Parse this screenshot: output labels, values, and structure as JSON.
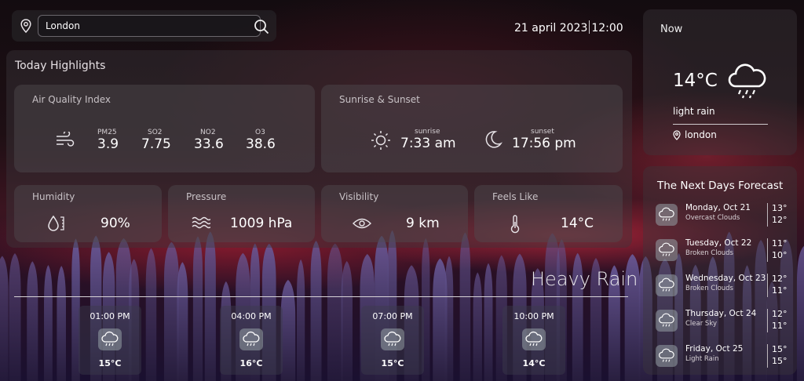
{
  "search": {
    "value": "London"
  },
  "header": {
    "date": "21 april 2023",
    "time": "12:00"
  },
  "highlights": {
    "title": "Today Highlights",
    "air_quality": {
      "label": "Air Quality Index",
      "items": [
        {
          "name": "PM25",
          "value": "3.9"
        },
        {
          "name": "SO2",
          "value": "7.75"
        },
        {
          "name": "NO2",
          "value": "33.6"
        },
        {
          "name": "O3",
          "value": "38.6"
        }
      ]
    },
    "sun": {
      "label": "Sunrise & Sunset",
      "sunrise_label": "sunrise",
      "sunrise": "7:33 am",
      "sunset_label": "sunset",
      "sunset": "17:56 pm"
    },
    "humidity": {
      "label": "Humidity",
      "value": "90%"
    },
    "pressure": {
      "label": "Pressure",
      "value": "1009 hPa"
    },
    "visibility": {
      "label": "Visibility",
      "value": "9 km"
    },
    "feels_like": {
      "label": "Feels Like",
      "value": "14°C"
    }
  },
  "condition": "Heavy Rain",
  "hourly": [
    {
      "time": "01:00 PM",
      "temp": "15°C",
      "icon": "cloud-rain-icon"
    },
    {
      "time": "04:00 PM",
      "temp": "16°C",
      "icon": "cloud-rain-icon"
    },
    {
      "time": "07:00 PM",
      "temp": "15°C",
      "icon": "cloud-rain-icon"
    },
    {
      "time": "10:00 PM",
      "temp": "14°C",
      "icon": "cloud-rain-icon"
    }
  ],
  "now": {
    "label": "Now",
    "temp": "14°C",
    "description": "light rain",
    "location": "london"
  },
  "forecast": {
    "title": "The Next Days Forecast",
    "days": [
      {
        "day": "Monday, Oct 21",
        "desc": "Overcast Clouds",
        "high": "13°",
        "low": "12°"
      },
      {
        "day": "Tuesday, Oct 22",
        "desc": "Broken Clouds",
        "high": "11°",
        "low": "10°"
      },
      {
        "day": "Wednesday, Oct 23",
        "desc": "Broken Clouds",
        "high": "12°",
        "low": "11°"
      },
      {
        "day": "Thursday, Oct 24",
        "desc": "Clear Sky",
        "high": "12°",
        "low": "11°"
      },
      {
        "day": "Friday, Oct 25",
        "desc": "Light Rain",
        "high": "15°",
        "low": "15°"
      }
    ]
  }
}
